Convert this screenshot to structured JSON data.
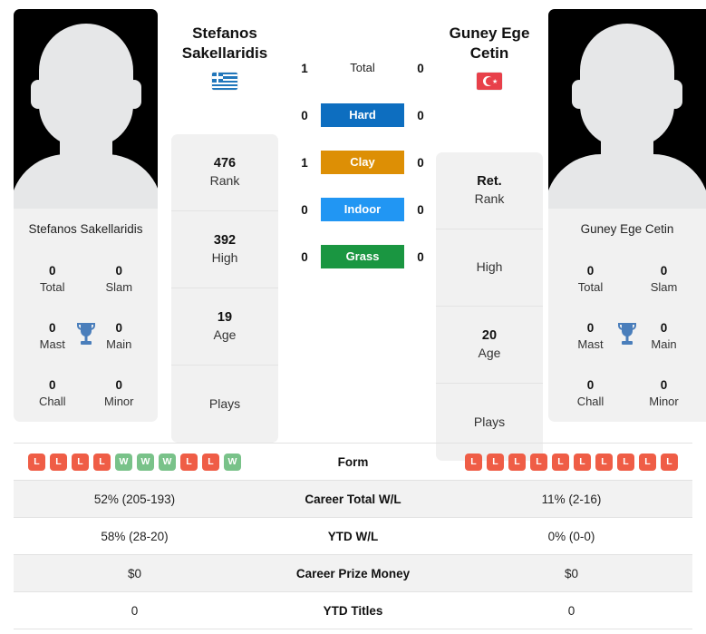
{
  "players": {
    "left": {
      "name": "Stefanos Sakellaridis",
      "name_line1": "Stefanos",
      "name_line2": "Sakellaridis",
      "flag": "greece-flag-icon",
      "card_name": "Stefanos Sakellaridis",
      "titles": [
        {
          "value": "0",
          "label": "Total"
        },
        {
          "value": "0",
          "label": "Slam"
        },
        {
          "value": "0",
          "label": "Mast"
        },
        {
          "value": "0",
          "label": "Main"
        },
        {
          "value": "0",
          "label": "Chall"
        },
        {
          "value": "0",
          "label": "Minor"
        }
      ],
      "stats": [
        {
          "value": "476",
          "label": "Rank"
        },
        {
          "value": "392",
          "label": "High"
        },
        {
          "value": "19",
          "label": "Age"
        },
        {
          "value": "",
          "label": "Plays"
        }
      ],
      "form": [
        "L",
        "L",
        "L",
        "L",
        "W",
        "W",
        "W",
        "L",
        "L",
        "W"
      ]
    },
    "right": {
      "name": "Guney Ege Cetin",
      "name_line1": "Guney Ege",
      "name_line2": "Cetin",
      "flag": "turkey-flag-icon",
      "card_name": "Guney Ege Cetin",
      "titles": [
        {
          "value": "0",
          "label": "Total"
        },
        {
          "value": "0",
          "label": "Slam"
        },
        {
          "value": "0",
          "label": "Mast"
        },
        {
          "value": "0",
          "label": "Main"
        },
        {
          "value": "0",
          "label": "Chall"
        },
        {
          "value": "0",
          "label": "Minor"
        }
      ],
      "stats": [
        {
          "value": "Ret.",
          "label": "Rank"
        },
        {
          "value": "",
          "label": "High"
        },
        {
          "value": "20",
          "label": "Age"
        },
        {
          "value": "",
          "label": "Plays"
        }
      ],
      "form": [
        "L",
        "L",
        "L",
        "L",
        "L",
        "L",
        "L",
        "L",
        "L",
        "L"
      ]
    }
  },
  "head_to_head": [
    {
      "label": "Total",
      "left": "1",
      "right": "0",
      "color": "",
      "plain": true
    },
    {
      "label": "Hard",
      "left": "0",
      "right": "0",
      "color": "#0d6ec0"
    },
    {
      "label": "Clay",
      "left": "1",
      "right": "0",
      "color": "#dd8f05"
    },
    {
      "label": "Indoor",
      "left": "0",
      "right": "0",
      "color": "#2196f3"
    },
    {
      "label": "Grass",
      "left": "0",
      "right": "0",
      "color": "#1a9641"
    }
  ],
  "table": {
    "form_label": "Form",
    "rows": [
      {
        "label": "Career Total W/L",
        "left": "52% (205-193)",
        "right": "11% (2-16)"
      },
      {
        "label": "YTD W/L",
        "left": "58% (28-20)",
        "right": "0% (0-0)"
      },
      {
        "label": "Career Prize Money",
        "left": "$0",
        "right": "$0"
      },
      {
        "label": "YTD Titles",
        "left": "0",
        "right": "0"
      }
    ]
  },
  "colors": {
    "hard": "#0d6ec0",
    "clay": "#dd8f05",
    "indoor": "#2196f3",
    "grass": "#1a9641",
    "win_badge": "#79c289",
    "loss_badge": "#ef5d46",
    "card_bg": "#f1f1f1"
  }
}
